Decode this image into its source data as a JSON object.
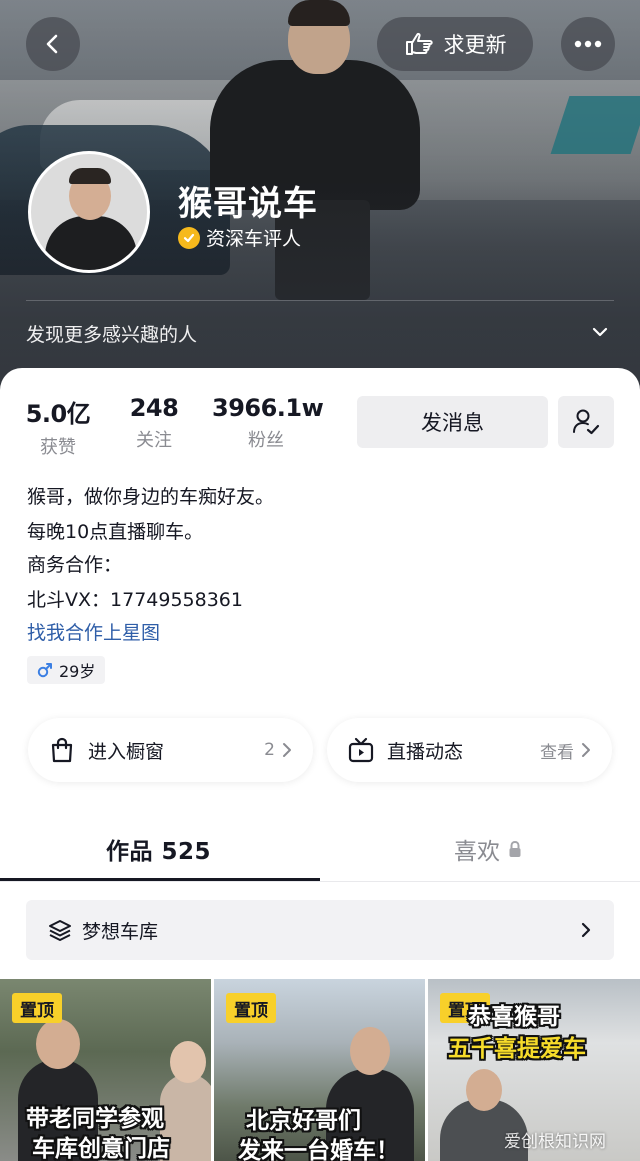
{
  "header": {
    "update_label": "求更新",
    "discover_label": "发现更多感兴趣的人"
  },
  "profile": {
    "nickname": "猴哥说车",
    "verification": "资深车评人"
  },
  "stats": [
    {
      "value": "5.0亿",
      "label": "获赞"
    },
    {
      "value": "248",
      "label": "关注"
    },
    {
      "value": "3966.1w",
      "label": "粉丝"
    }
  ],
  "actions": {
    "message_label": "发消息"
  },
  "bio": {
    "lines": [
      "猴哥，做你身边的车痴好友。",
      "每晚10点直播聊车。",
      "商务合作：",
      "北斗VX：17749558361"
    ],
    "link": "找我合作上星图",
    "age": "29岁"
  },
  "entries": {
    "shop_label": "进入橱窗",
    "shop_count": "2",
    "live_label": "直播动态",
    "live_action": "查看"
  },
  "tabs": {
    "works": "作品 525",
    "likes": "喜欢"
  },
  "garage": {
    "label": "梦想车库"
  },
  "videos": [
    {
      "pin": "置顶",
      "caption_1": "带老同学参观",
      "caption_2": "车库创意门店"
    },
    {
      "pin": "置顶",
      "caption_1": "北京好哥们",
      "caption_2": "发来一台婚车！"
    },
    {
      "pin": "置顶",
      "caption_1": "恭喜猴哥",
      "caption_2": "五千喜提爱车"
    }
  ],
  "watermark": "爱创根知识网",
  "colors": {
    "accent_link": "#2f5ea8",
    "verify_badge": "#f6b91c",
    "pin_tag": "#f8d02a",
    "male_icon": "#3b7fe3"
  }
}
